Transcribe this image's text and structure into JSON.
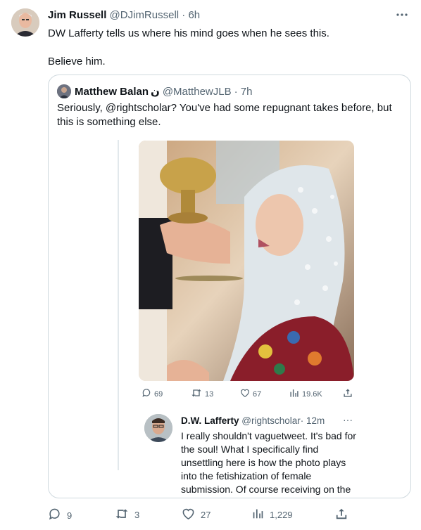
{
  "tweet": {
    "author_name": "Jim Russell",
    "author_handle": "@DJimRussell",
    "time": "· 6h",
    "line1": "DW Lafferty tells us where his mind goes when he sees this.",
    "line2": "Believe him."
  },
  "quote": {
    "author_name": "Matthew Balan",
    "name_suffix": "ن",
    "author_handle": "@MatthewJLB",
    "time": "· 7h",
    "text": "Seriously, @rightscholar? You've had some repugnant takes before, but this is something else.",
    "inner": {
      "actions": {
        "replies": "69",
        "retweets": "13",
        "likes": "67",
        "views": "19.6K"
      },
      "reply": {
        "author_name": "D.W. Lafferty",
        "author_handle": "@rightscholar",
        "time": "· 12m",
        "more": "···",
        "text": "I really shouldn't vaguetweet. It's bad for the soul! What I specifically find unsettling here is how the photo plays into the fetishization of female submission. Of course receiving on the tongue is not in itself bad or weird, but"
      }
    }
  },
  "actions": {
    "replies": "9",
    "retweets": "3",
    "likes": "27",
    "views": "1,229"
  },
  "colors": {
    "text": "#0f1419",
    "secondary": "#536471",
    "border": "#cfd9de"
  }
}
